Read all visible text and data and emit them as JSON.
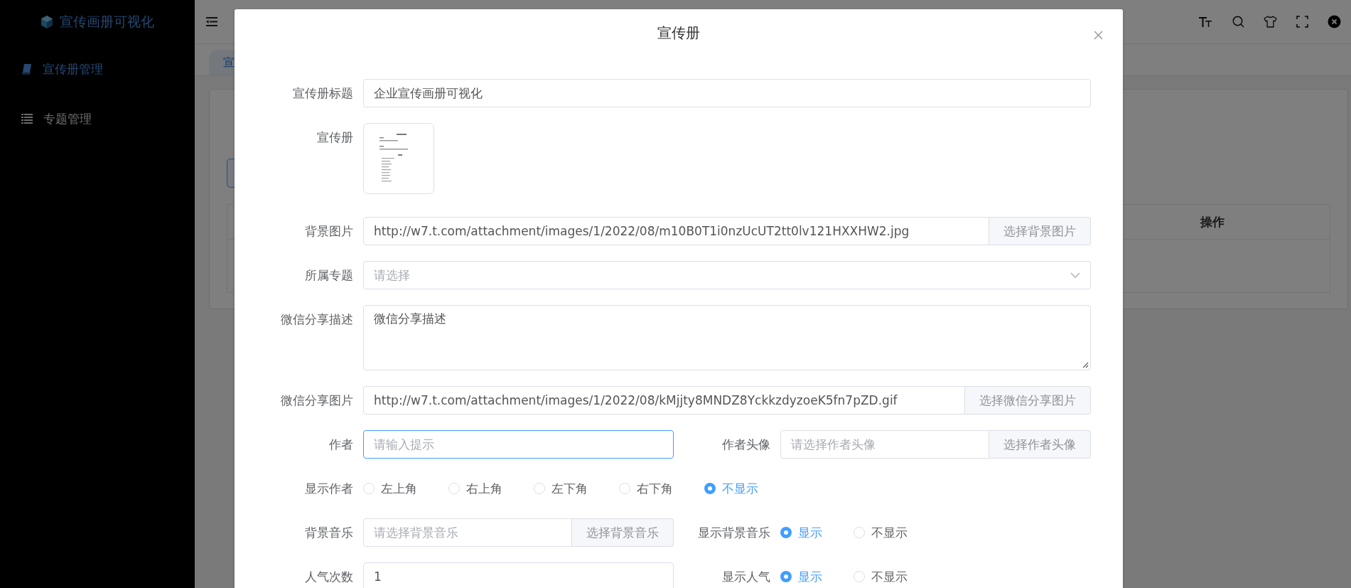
{
  "sidebar": {
    "title": "宣传画册可视化",
    "items": [
      {
        "label": "宣传册管理",
        "selected": true
      },
      {
        "label": "专题管理",
        "selected": false
      }
    ]
  },
  "tabs": [
    {
      "label": "宣",
      "selected": true
    }
  ],
  "table": {
    "columns": [
      "操作"
    ]
  },
  "dialog": {
    "title": "宣传册",
    "fields": [
      {
        "kind": "text",
        "label": "宣传册标题",
        "value": "企业宣传画册可视化"
      },
      {
        "label": "宣传册"
      },
      {
        "kind": "append",
        "label": "背景图片",
        "value": "http://w7.t.com/attachment/images/1/2022/08/m10B0T1i0nzUcUT2tt0lv121HXXHW2.jpg",
        "button": "选择背景图片"
      },
      {
        "kind": "select",
        "label": "所属专题",
        "placeholder": "请选择"
      },
      {
        "kind": "textarea",
        "label": "微信分享描述",
        "value": "微信分享描述"
      },
      {
        "kind": "append",
        "label": "微信分享图片",
        "value": "http://w7.t.com/attachment/images/1/2022/08/kMjjty8MNDZ8YckkzdyzoeK5fn7pZD.gif",
        "button": "选择微信分享图片"
      },
      {
        "kind": "pair",
        "left": {
          "kind": "text",
          "label": "作者",
          "placeholder": "请输入提示",
          "focused": true
        },
        "right": {
          "kind": "append",
          "label": "作者头像",
          "placeholder": "请选择作者头像",
          "button": "选择作者头像"
        }
      },
      {
        "kind": "radios",
        "label": "显示作者",
        "options": [
          {
            "label": "左上角",
            "selected": false
          },
          {
            "label": "右上角",
            "selected": false
          },
          {
            "label": "左下角",
            "selected": false
          },
          {
            "label": "右下角",
            "selected": false
          },
          {
            "label": "不显示",
            "selected": true
          }
        ]
      },
      {
        "kind": "pair",
        "left": {
          "kind": "append",
          "label": "背景音乐",
          "placeholder": "请选择背景音乐",
          "button": "选择背景音乐"
        },
        "right": {
          "kind": "radios",
          "label": "显示背景音乐",
          "options": [
            {
              "label": "显示",
              "selected": true
            },
            {
              "label": "不显示",
              "selected": false
            }
          ]
        }
      },
      {
        "kind": "pair",
        "left": {
          "kind": "text",
          "label": "人气次数",
          "value": "1"
        },
        "right": {
          "kind": "radios",
          "label": "显示人气",
          "options": [
            {
              "label": "显示",
              "selected": true
            },
            {
              "label": "不显示",
              "selected": false
            }
          ]
        }
      }
    ]
  }
}
